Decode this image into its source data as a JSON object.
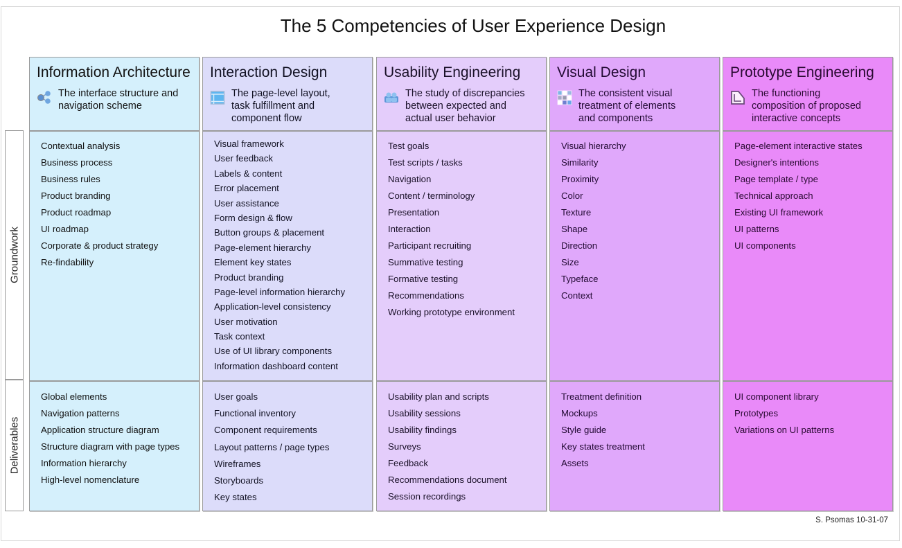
{
  "title": "The 5 Competencies of User Experience Design",
  "row_labels": {
    "groundwork": "Groundwork",
    "deliverables": "Deliverables"
  },
  "credit": "S. Psomas 10-31-07",
  "columns": [
    {
      "name": "Information Architecture",
      "icon": "network-nodes-icon",
      "bg": "#d5f0fc",
      "text_color": "#111111",
      "description": [
        "The interface structure and",
        "navigation scheme"
      ],
      "groundwork": [
        "Contextual analysis",
        "Business process",
        "Business rules",
        "Product branding",
        "Product roadmap",
        "UI roadmap",
        "Corporate & product strategy",
        "Re-findability"
      ],
      "deliverables": [
        "Global elements",
        "Navigation patterns",
        "Application structure diagram",
        "Structure diagram with page types",
        "Information hierarchy",
        "High-level nomenclature"
      ]
    },
    {
      "name": "Interaction Design",
      "icon": "page-layout-icon",
      "bg": "#dcdcfa",
      "text_color": "#111122",
      "description": [
        "The page-level layout,",
        "task fulfillment and",
        "component flow"
      ],
      "groundwork": [
        "Visual framework",
        "User feedback",
        "Labels & content",
        "Error placement",
        "User assistance",
        "Form design & flow",
        "Button groups & placement",
        "Page-element hierarchy",
        "Element key states",
        "Product branding",
        "Page-level information hierarchy",
        "Application-level consistency",
        "User motivation",
        "Task context",
        "Use of UI library components",
        "Information dashboard content"
      ],
      "deliverables": [
        "User goals",
        "Functional inventory",
        "Component requirements",
        "Layout patterns / page types",
        "Wireframes",
        "Storyboards",
        "Key states"
      ]
    },
    {
      "name": "Usability Engineering",
      "icon": "users-group-icon",
      "bg": "#e4cdfb",
      "text_color": "#1a1128",
      "description": [
        "The study of discrepancies",
        "between expected and",
        "actual user behavior"
      ],
      "groundwork": [
        "Test goals",
        "Test scripts / tasks",
        "Navigation",
        "Content / terminology",
        "Presentation",
        "Interaction",
        "Participant recruiting",
        "Summative testing",
        "Formative testing",
        "Recommendations",
        "Working prototype environment"
      ],
      "deliverables": [
        "Usability plan and scripts",
        "Usability sessions",
        "Usability findings",
        "Surveys",
        "Feedback",
        "Recommendations document",
        "Session recordings"
      ]
    },
    {
      "name": "Visual Design",
      "icon": "color-grid-icon",
      "bg": "#e0a8fb",
      "text_color": "#220a33",
      "description": [
        "The consistent visual",
        "treatment of elements",
        "and components"
      ],
      "groundwork": [
        "Visual hierarchy",
        "Similarity",
        "Proximity",
        "Color",
        "Texture",
        "Shape",
        "Direction",
        "Size",
        "Typeface",
        "Context"
      ],
      "deliverables": [
        "Treatment definition",
        "Mockups",
        "Style guide",
        "Key states treatment",
        "Assets"
      ]
    },
    {
      "name": "Prototype Engineering",
      "icon": "prototype-page-icon",
      "bg": "#e98af9",
      "text_color": "#2a0a33",
      "description": [
        "The functioning",
        "composition of proposed",
        "interactive concepts"
      ],
      "groundwork": [
        "Page-element interactive states",
        "Designer's intentions",
        "Page template / type",
        "Technical approach",
        "Existing UI framework",
        "UI patterns",
        "UI components"
      ],
      "deliverables": [
        "UI component library",
        "Prototypes",
        "Variations on UI patterns"
      ]
    }
  ]
}
